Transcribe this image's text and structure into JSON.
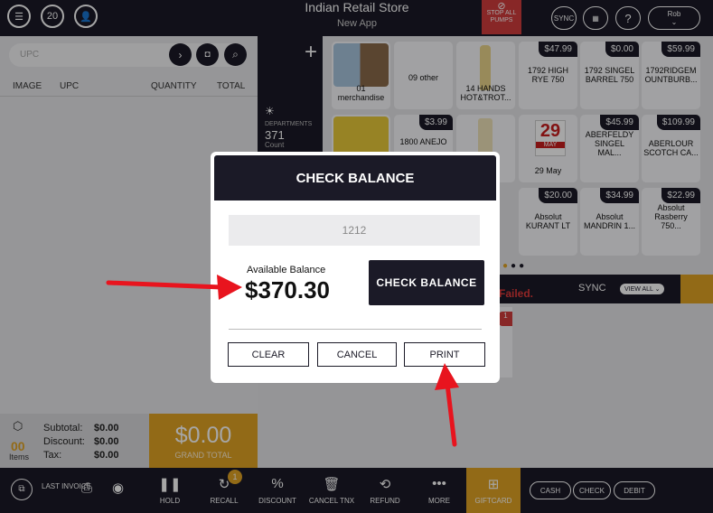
{
  "topbar": {
    "title": "Indian Retail Store",
    "subtitle": "New App",
    "calendar_day": "20",
    "stop_pumps": "STOP ALL PUMPS",
    "sync": "SYNC",
    "help": "?",
    "user": "Rob"
  },
  "left": {
    "upc_placeholder": "UPC",
    "columns": [
      "IMAGE",
      "UPC",
      "QUANTITY",
      "TOTAL"
    ],
    "items_count": "00",
    "items_label": "Items",
    "subtotal_label": "Subtotal:",
    "subtotal": "$0.00",
    "discount_label": "Discount:",
    "discount": "$0.00",
    "tax_label": "Tax:",
    "tax": "$0.00",
    "grand_total": "$0.00",
    "grand_total_label": "GRAND TOTAL"
  },
  "departments": {
    "label": "DEPARTMENTS",
    "count": "371",
    "count_label": "Count"
  },
  "tiles": [
    {
      "name": "01 merchandise",
      "price": ""
    },
    {
      "name": "09 other",
      "price": ""
    },
    {
      "name": "14 HANDS HOT&TROT...",
      "price": ""
    },
    {
      "name": "1792 HIGH RYE 750",
      "price": "$47.99"
    },
    {
      "name": "1792 SINGEL BARREL 750",
      "price": "$0.00"
    },
    {
      "name": "1792RIDGEM OUNTBURB...",
      "price": "$59.99"
    },
    {
      "name": "1800 ANEJO",
      "price": "$3.99"
    },
    {
      "name": "29 May",
      "price": ""
    },
    {
      "name": "ABERFELDY SINGEL MAL...",
      "price": "$45.99"
    },
    {
      "name": "ABERLOUR SCOTCH CA...",
      "price": "$109.99"
    },
    {
      "name": "Absolut KURANT LT",
      "price": "$20.00"
    },
    {
      "name": "Absolut MANDRIN 1...",
      "price": "$34.99"
    },
    {
      "name": "Absolut Rasberry 750...",
      "price": "$22.99"
    }
  ],
  "calendar_tile": {
    "day": "29",
    "month": "MAY"
  },
  "sync_panel": {
    "failed": "Failed.",
    "sync": "SYNC",
    "view_all": "VIEW ALL",
    "badge": "1"
  },
  "modal": {
    "title": "CHECK BALANCE",
    "card_number": "1212",
    "available_label": "Available Balance",
    "available_amount": "$370.30",
    "check_balance": "CHECK BALANCE",
    "clear": "CLEAR",
    "cancel": "CANCEL",
    "print": "PRINT"
  },
  "toolbar": {
    "last_invoice": "LAST INVOICE",
    "hold": "HOLD",
    "recall": "RECALL",
    "recall_badge": "1",
    "discount": "DISCOUNT",
    "cancel_tnx": "CANCEL TNX",
    "refund": "REFUND",
    "more": "MORE",
    "giftcard": "GIFTCARD",
    "cash": "CASH",
    "check": "CHECK",
    "debit": "DEBIT"
  },
  "colors": {
    "dark": "#1b1a27",
    "accent": "#e1a324",
    "alert": "#d23c3c",
    "annotation": "#e8141e"
  }
}
